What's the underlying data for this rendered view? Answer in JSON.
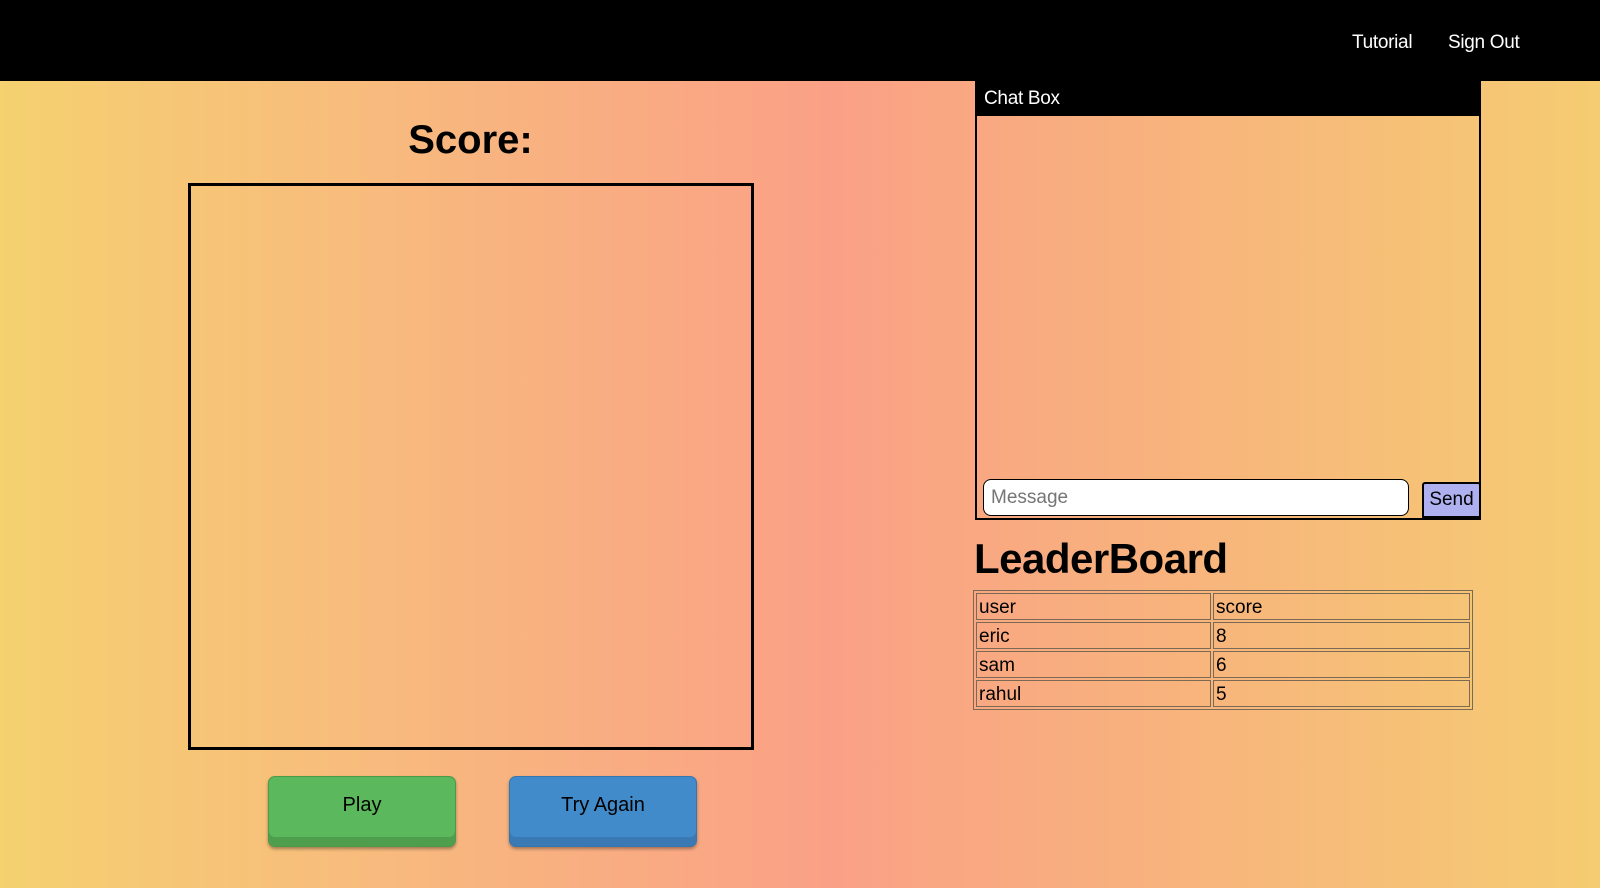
{
  "nav": {
    "links": [
      "Tutorial",
      "Sign Out"
    ]
  },
  "game": {
    "score_label": "Score:",
    "play_label": "Play",
    "try_again_label": "Try Again"
  },
  "chat": {
    "title": "Chat Box",
    "input_placeholder": "Message",
    "input_value": "",
    "send_label": "Send"
  },
  "leaderboard": {
    "title": "LeaderBoard",
    "headers": [
      "user",
      "score"
    ],
    "rows": [
      [
        "eric",
        "8"
      ],
      [
        "sam",
        "6"
      ],
      [
        "rahul",
        "5"
      ]
    ]
  },
  "colors": {
    "navbar": "#000000",
    "play_button": "#5cb85c",
    "try_again_button": "#428bca",
    "send_button": "#aeb0f0",
    "background_gradient": [
      "#f5d170",
      "#faa086",
      "#f5cc72"
    ]
  }
}
